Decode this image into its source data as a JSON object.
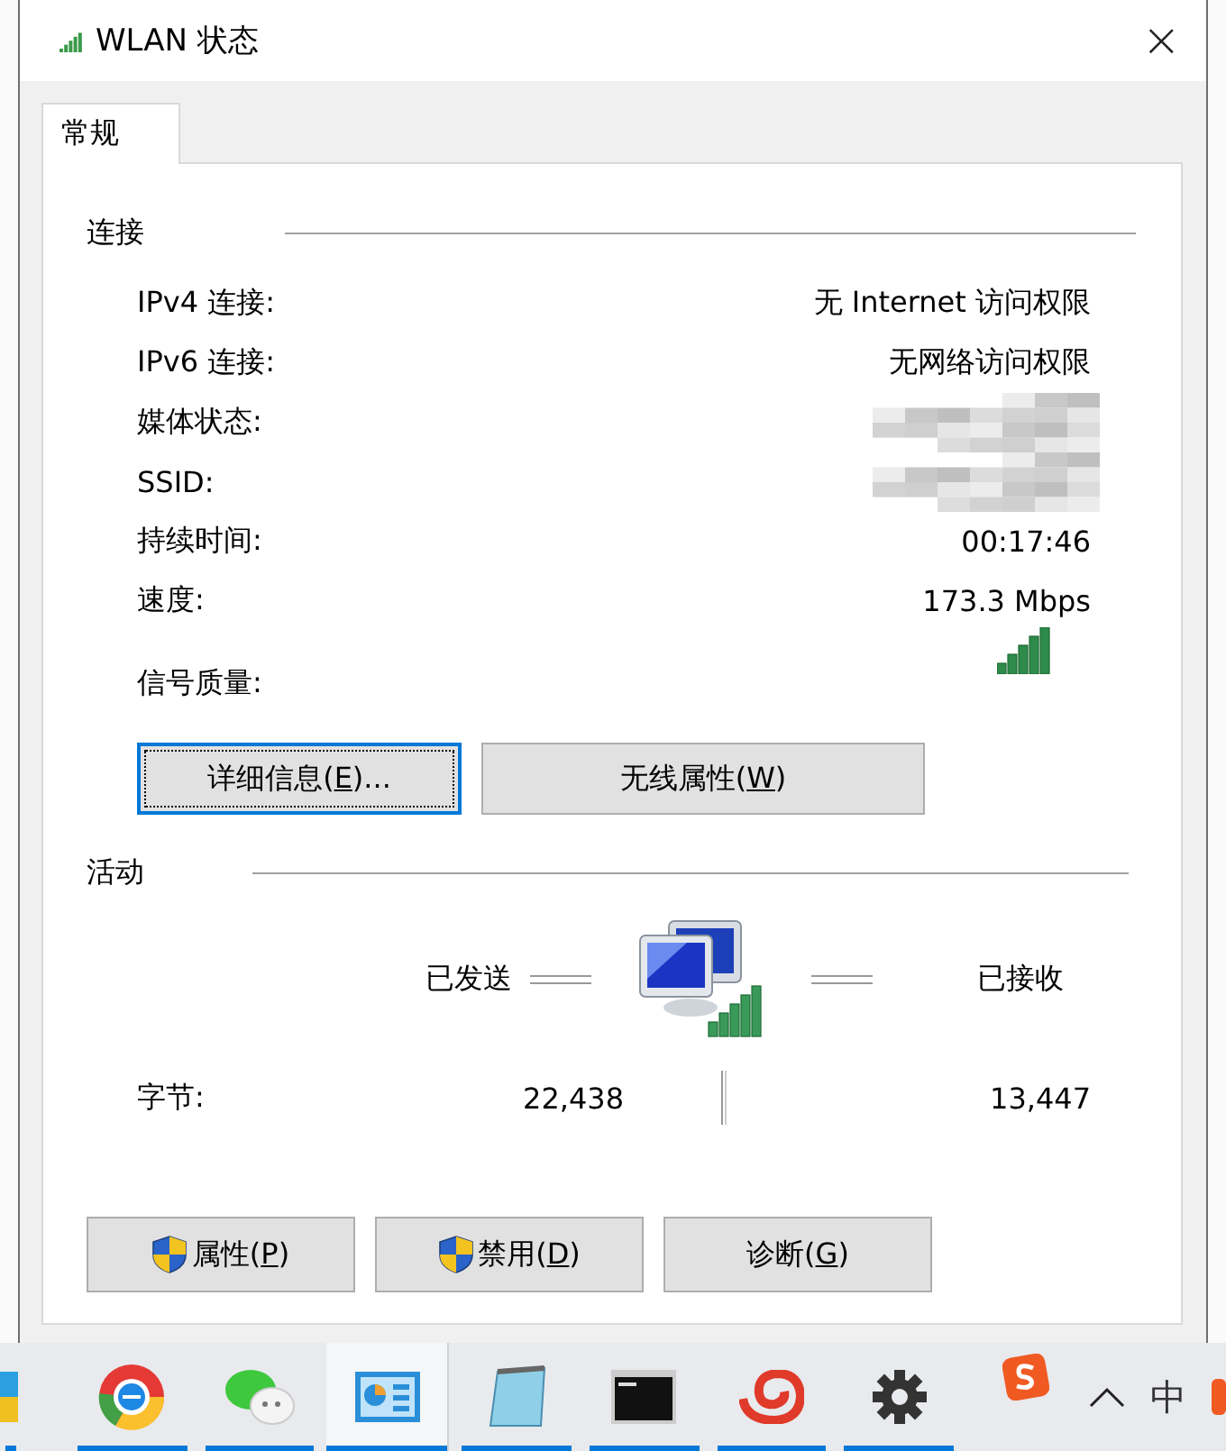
{
  "window": {
    "title": "WLAN 状态",
    "close": "×"
  },
  "tabs": [
    {
      "label": "常规",
      "selected": true
    }
  ],
  "connection": {
    "heading": "连接",
    "rows": [
      {
        "kind": "text",
        "label": "IPv4 连接:",
        "value": "无 Internet 访问权限"
      },
      {
        "kind": "text",
        "label": "IPv6 连接:",
        "value": "无网络访问权限"
      },
      {
        "kind": "redacted",
        "label": "媒体状态:"
      },
      {
        "kind": "redacted",
        "label": "SSID:"
      },
      {
        "kind": "text",
        "label": "持续时间:",
        "value": "00:17:46"
      },
      {
        "kind": "text",
        "label": "速度:",
        "value": "173.3 Mbps"
      },
      {
        "kind": "signal",
        "label": "信号质量:"
      }
    ],
    "buttons": [
      {
        "before": "详细信息(",
        "key": "E",
        "after": ")...",
        "focused": true
      },
      {
        "before": "无线属性(",
        "key": "W",
        "after": ")",
        "focused": false
      }
    ]
  },
  "activity": {
    "heading": "活动",
    "sent": "已发送",
    "received": "已接收",
    "bytes_label": "字节:",
    "bytes_sent": "22,438",
    "bytes_received": "13,447"
  },
  "buttons": [
    {
      "before": "属性(",
      "key": "P",
      "after": ")",
      "shield": true
    },
    {
      "before": "禁用(",
      "key": "D",
      "after": ")",
      "shield": true
    },
    {
      "before": "诊断(",
      "key": "G",
      "after": ")",
      "shield": false
    }
  ],
  "taskbar": {
    "apps": [
      {
        "running": true,
        "selected": false
      },
      {
        "running": true,
        "selected": false
      },
      {
        "running": true,
        "selected": false
      },
      {
        "running": true,
        "selected": true
      },
      {
        "running": true,
        "selected": false
      },
      {
        "running": true,
        "selected": false
      },
      {
        "running": true,
        "selected": false
      },
      {
        "running": true,
        "selected": false
      }
    ],
    "input_method": "中"
  }
}
